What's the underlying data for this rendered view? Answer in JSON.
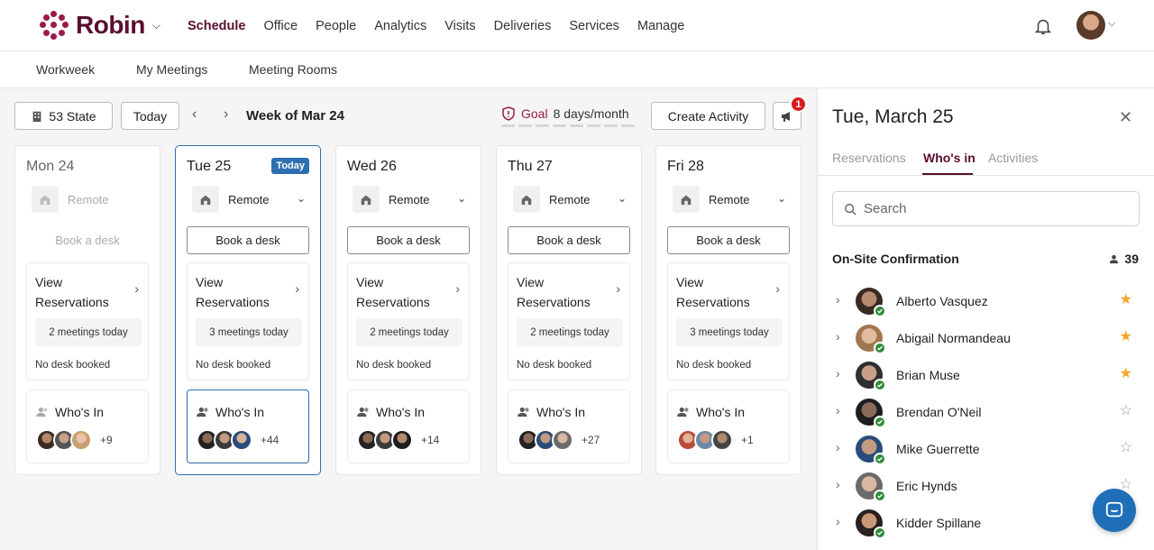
{
  "app": {
    "brand": "Robin"
  },
  "nav": {
    "items": [
      "Schedule",
      "Office",
      "People",
      "Analytics",
      "Visits",
      "Deliveries",
      "Services",
      "Manage"
    ],
    "active": "Schedule"
  },
  "subnav": {
    "items": [
      "Workweek",
      "My Meetings",
      "Meeting Rooms"
    ]
  },
  "toolbar": {
    "location": "53 State",
    "today": "Today",
    "week_label": "Week of Mar 24",
    "goal_label": "Goal",
    "goal_value": "8 days/month",
    "create_activity": "Create Activity",
    "notification_count": "1"
  },
  "days": [
    {
      "title": "Mon 24",
      "location": "Remote",
      "book": "Book a desk",
      "view_resv": "View Reservations",
      "meetings": "2 meetings today",
      "desk": "No desk booked",
      "who_in": "Who's In",
      "more": "+9"
    },
    {
      "title": "Tue 25",
      "today_badge": "Today",
      "location": "Remote",
      "book": "Book a desk",
      "view_resv": "View Reservations",
      "meetings": "3 meetings today",
      "desk": "No desk booked",
      "who_in": "Who's In",
      "more": "+44"
    },
    {
      "title": "Wed 26",
      "location": "Remote",
      "book": "Book a desk",
      "view_resv": "View Reservations",
      "meetings": "2 meetings today",
      "desk": "No desk booked",
      "who_in": "Who's In",
      "more": "+14"
    },
    {
      "title": "Thu 27",
      "location": "Remote",
      "book": "Book a desk",
      "view_resv": "View Reservations",
      "meetings": "2 meetings today",
      "desk": "No desk booked",
      "who_in": "Who's In",
      "more": "+27"
    },
    {
      "title": "Fri 28",
      "location": "Remote",
      "book": "Book a desk",
      "view_resv": "View Reservations",
      "meetings": "3 meetings today",
      "desk": "No desk booked",
      "who_in": "Who's In",
      "more": "+1"
    }
  ],
  "panel": {
    "date": "Tue, March 25",
    "tabs": [
      "Reservations",
      "Who's in",
      "Activities"
    ],
    "active_tab": "Who's in",
    "search_placeholder": "Search",
    "section_title": "On-Site Confirmation",
    "count": "39",
    "people": [
      {
        "name": "Alberto Vasquez",
        "starred": true
      },
      {
        "name": "Abigail Normandeau",
        "starred": true
      },
      {
        "name": "Brian Muse",
        "starred": true
      },
      {
        "name": "Brendan O'Neil",
        "starred": false
      },
      {
        "name": "Mike Guerrette",
        "starred": false
      },
      {
        "name": "Eric Hynds",
        "starred": false
      },
      {
        "name": "Kidder Spillane",
        "starred": false
      }
    ]
  },
  "colors": {
    "brand": "#5a0f2e",
    "accent": "#2e6fb0",
    "star": "#f5a623",
    "check": "#2e8b3a",
    "badge": "#d81b1b"
  }
}
